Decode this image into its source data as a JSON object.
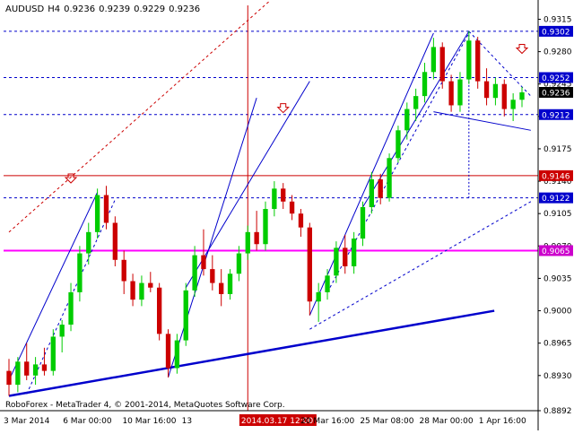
{
  "chart_data": {
    "type": "candlestick",
    "symbol": "AUDUSD",
    "timeframe": "H4",
    "ohlc_header": {
      "open": "0.9236",
      "high": "0.9239",
      "low": "0.9229",
      "close": "0.9236"
    },
    "copyright": "RoboForex - MetaTrader 4, © 2001-2014, MetaQuotes Software Corp.",
    "ylim": [
      0.8892,
      0.933
    ],
    "y_ticks": [
      "0.9315",
      "0.9280",
      "0.9245",
      "0.9210",
      "0.9175",
      "0.9140",
      "0.9105",
      "0.9070",
      "0.9035",
      "0.9000",
      "0.8965",
      "0.8930",
      "0.8892"
    ],
    "x_ticks": [
      "3 Mar 2014",
      "6 Mar 00:00",
      "10 Mar 16:00",
      "13",
      "2014.03.17 12:00",
      "20 Mar 16:00",
      "25 Mar 08:00",
      "28 Mar 00:00",
      "1 Apr 16:00"
    ],
    "price_labels": [
      {
        "value": "0.9302",
        "price": 0.9302,
        "color": "#0000cc"
      },
      {
        "value": "0.9252",
        "price": 0.9252,
        "color": "#0000cc"
      },
      {
        "value": "0.9236",
        "price": 0.9236,
        "color": "#000000"
      },
      {
        "value": "0.9212",
        "price": 0.9212,
        "color": "#0000cc"
      },
      {
        "value": "0.9146",
        "price": 0.9146,
        "color": "#cc0000"
      },
      {
        "value": "0.9122",
        "price": 0.9122,
        "color": "#0000cc"
      },
      {
        "value": "0.9065",
        "price": 0.9065,
        "color": "#cc00cc"
      }
    ],
    "horizontal_levels": [
      {
        "price": 0.9302,
        "color": "#0000cc",
        "style": "dashed"
      },
      {
        "price": 0.9252,
        "color": "#0000cc",
        "style": "dashed"
      },
      {
        "price": 0.9212,
        "color": "#0000cc",
        "style": "dashed"
      },
      {
        "price": 0.9146,
        "color": "#cc0000",
        "style": "solid"
      },
      {
        "price": 0.9122,
        "color": "#0000cc",
        "style": "dashed"
      },
      {
        "price": 0.9065,
        "color": "#ff00ff",
        "style": "solid"
      }
    ],
    "series": [
      {
        "open": 0.8935,
        "high": 0.8948,
        "low": 0.8908,
        "close": 0.892
      },
      {
        "open": 0.892,
        "high": 0.895,
        "low": 0.8912,
        "close": 0.8945
      },
      {
        "open": 0.8945,
        "high": 0.8965,
        "low": 0.8925,
        "close": 0.893
      },
      {
        "open": 0.893,
        "high": 0.895,
        "low": 0.892,
        "close": 0.8942
      },
      {
        "open": 0.8942,
        "high": 0.896,
        "low": 0.893,
        "close": 0.8935
      },
      {
        "open": 0.8935,
        "high": 0.898,
        "low": 0.893,
        "close": 0.8972
      },
      {
        "open": 0.8972,
        "high": 0.899,
        "low": 0.8955,
        "close": 0.8985
      },
      {
        "open": 0.8985,
        "high": 0.903,
        "low": 0.8978,
        "close": 0.902
      },
      {
        "open": 0.902,
        "high": 0.907,
        "low": 0.901,
        "close": 0.9062
      },
      {
        "open": 0.9062,
        "high": 0.9095,
        "low": 0.905,
        "close": 0.9085
      },
      {
        "open": 0.9085,
        "high": 0.9132,
        "low": 0.9078,
        "close": 0.9125
      },
      {
        "open": 0.9125,
        "high": 0.9135,
        "low": 0.9088,
        "close": 0.9095
      },
      {
        "open": 0.9095,
        "high": 0.9102,
        "low": 0.9048,
        "close": 0.9055
      },
      {
        "open": 0.9055,
        "high": 0.9065,
        "low": 0.9018,
        "close": 0.9032
      },
      {
        "open": 0.9032,
        "high": 0.904,
        "low": 0.9005,
        "close": 0.9012
      },
      {
        "open": 0.9012,
        "high": 0.9038,
        "low": 0.9005,
        "close": 0.903
      },
      {
        "open": 0.903,
        "high": 0.9042,
        "low": 0.902,
        "close": 0.9025
      },
      {
        "open": 0.9025,
        "high": 0.903,
        "low": 0.8968,
        "close": 0.8975
      },
      {
        "open": 0.8975,
        "high": 0.898,
        "low": 0.8928,
        "close": 0.8938
      },
      {
        "open": 0.8938,
        "high": 0.8975,
        "low": 0.8932,
        "close": 0.8968
      },
      {
        "open": 0.8968,
        "high": 0.903,
        "low": 0.8962,
        "close": 0.9022
      },
      {
        "open": 0.9022,
        "high": 0.907,
        "low": 0.9015,
        "close": 0.906
      },
      {
        "open": 0.906,
        "high": 0.9088,
        "low": 0.9038,
        "close": 0.9045
      },
      {
        "open": 0.9045,
        "high": 0.906,
        "low": 0.9022,
        "close": 0.903
      },
      {
        "open": 0.903,
        "high": 0.9045,
        "low": 0.9005,
        "close": 0.9018
      },
      {
        "open": 0.9018,
        "high": 0.9045,
        "low": 0.9012,
        "close": 0.904
      },
      {
        "open": 0.904,
        "high": 0.907,
        "low": 0.9032,
        "close": 0.9062
      },
      {
        "open": 0.9062,
        "high": 0.9092,
        "low": 0.9055,
        "close": 0.9085
      },
      {
        "open": 0.9085,
        "high": 0.9108,
        "low": 0.9065,
        "close": 0.9072
      },
      {
        "open": 0.9072,
        "high": 0.9118,
        "low": 0.9065,
        "close": 0.911
      },
      {
        "open": 0.911,
        "high": 0.914,
        "low": 0.9102,
        "close": 0.9132
      },
      {
        "open": 0.9132,
        "high": 0.9138,
        "low": 0.911,
        "close": 0.9118
      },
      {
        "open": 0.9118,
        "high": 0.9125,
        "low": 0.9098,
        "close": 0.9105
      },
      {
        "open": 0.9105,
        "high": 0.911,
        "low": 0.908,
        "close": 0.909
      },
      {
        "open": 0.909,
        "high": 0.9095,
        "low": 0.8995,
        "close": 0.901
      },
      {
        "open": 0.901,
        "high": 0.903,
        "low": 0.8988,
        "close": 0.902
      },
      {
        "open": 0.902,
        "high": 0.9045,
        "low": 0.9012,
        "close": 0.9038
      },
      {
        "open": 0.9038,
        "high": 0.9075,
        "low": 0.903,
        "close": 0.9068
      },
      {
        "open": 0.9068,
        "high": 0.9082,
        "low": 0.904,
        "close": 0.9048
      },
      {
        "open": 0.9048,
        "high": 0.9085,
        "low": 0.904,
        "close": 0.9078
      },
      {
        "open": 0.9078,
        "high": 0.9118,
        "low": 0.907,
        "close": 0.9112
      },
      {
        "open": 0.9112,
        "high": 0.915,
        "low": 0.9105,
        "close": 0.9142
      },
      {
        "open": 0.9142,
        "high": 0.9148,
        "low": 0.9115,
        "close": 0.9122
      },
      {
        "open": 0.9122,
        "high": 0.917,
        "low": 0.9118,
        "close": 0.9165
      },
      {
        "open": 0.9165,
        "high": 0.92,
        "low": 0.916,
        "close": 0.9195
      },
      {
        "open": 0.9195,
        "high": 0.9225,
        "low": 0.9185,
        "close": 0.9218
      },
      {
        "open": 0.9218,
        "high": 0.924,
        "low": 0.9205,
        "close": 0.9232
      },
      {
        "open": 0.9232,
        "high": 0.9268,
        "low": 0.9225,
        "close": 0.9258
      },
      {
        "open": 0.9258,
        "high": 0.9295,
        "low": 0.925,
        "close": 0.9285
      },
      {
        "open": 0.9285,
        "high": 0.929,
        "low": 0.924,
        "close": 0.9248
      },
      {
        "open": 0.9248,
        "high": 0.9255,
        "low": 0.9215,
        "close": 0.9222
      },
      {
        "open": 0.9222,
        "high": 0.9258,
        "low": 0.9215,
        "close": 0.925
      },
      {
        "open": 0.925,
        "high": 0.9302,
        "low": 0.9245,
        "close": 0.9292
      },
      {
        "open": 0.9292,
        "high": 0.9296,
        "low": 0.924,
        "close": 0.9248
      },
      {
        "open": 0.9248,
        "high": 0.9262,
        "low": 0.9222,
        "close": 0.923
      },
      {
        "open": 0.923,
        "high": 0.9252,
        "low": 0.9222,
        "close": 0.9245
      },
      {
        "open": 0.9245,
        "high": 0.925,
        "low": 0.921,
        "close": 0.9218
      },
      {
        "open": 0.9218,
        "high": 0.9235,
        "low": 0.9205,
        "close": 0.9228
      },
      {
        "open": 0.9228,
        "high": 0.9242,
        "low": 0.922,
        "close": 0.9236
      }
    ],
    "annotations": [
      {
        "type": "arrow-down",
        "color": "#cc0000",
        "price": 0.9142,
        "index": 12
      },
      {
        "type": "arrow-down",
        "color": "#cc0000",
        "price": 0.9218,
        "index": 54
      },
      {
        "type": "arrow-down",
        "color": "#cc0000",
        "price": 0.9282,
        "index": 100
      }
    ],
    "grid": false,
    "legend": "none"
  }
}
